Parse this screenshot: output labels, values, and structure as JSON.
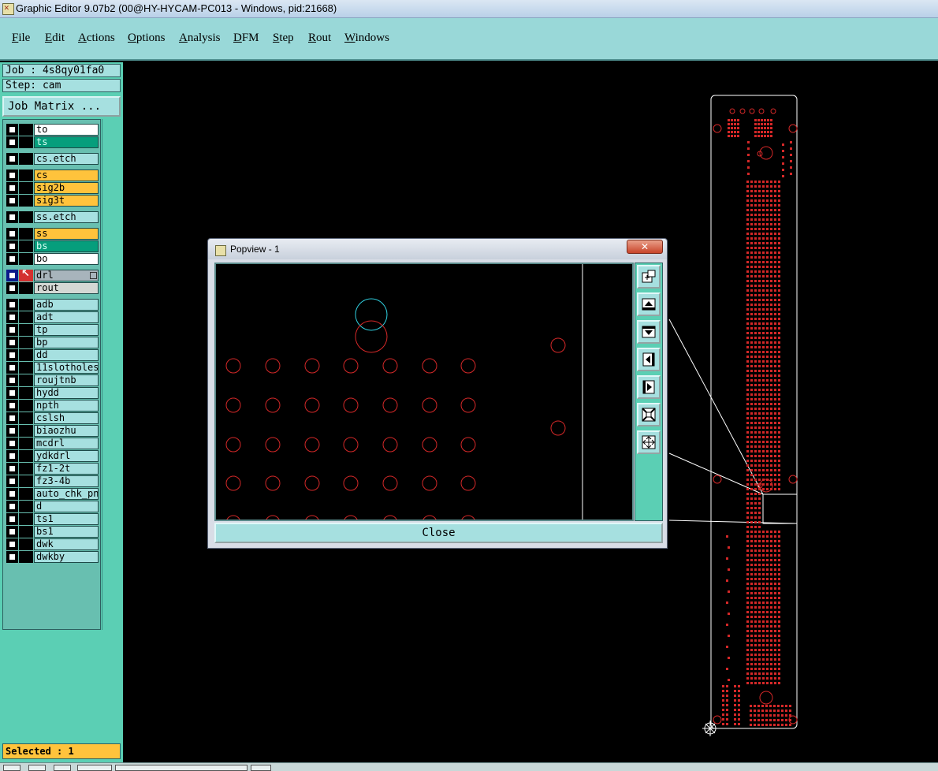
{
  "window": {
    "title": "Graphic Editor 9.07b2 (00@HY-HYCAM-PC013 - Windows, pid:21668)"
  },
  "menu": [
    "File",
    "Edit",
    "Actions",
    "Options",
    "Analysis",
    "DFM",
    "Step",
    "Rout",
    "Windows"
  ],
  "job": {
    "label": "Job : 4s8qy01fa0",
    "step": "Step: cam",
    "matrix_button": "Job Matrix ..."
  },
  "layers": [
    {
      "name": "to",
      "color": "#ffffff"
    },
    {
      "name": "ts",
      "color": "#069e7c"
    },
    {
      "name": "cs.etch",
      "color": "#a6e0e0"
    },
    {
      "name": "cs",
      "color": "#ffc33c"
    },
    {
      "name": "sig2b",
      "color": "#ffc33c"
    },
    {
      "name": "sig3t",
      "color": "#ffc33c"
    },
    {
      "name": "ss.etch",
      "color": "#a6e0e0"
    },
    {
      "name": "ss",
      "color": "#ffc33c"
    },
    {
      "name": "bs",
      "color": "#069e7c"
    },
    {
      "name": "bo",
      "color": "#ffffff"
    },
    {
      "name": "drl",
      "color": "#a8b4bc",
      "active": true
    },
    {
      "name": "rout",
      "color": "#d4d8d4"
    },
    {
      "name": "adb",
      "color": "#a6e0e0"
    },
    {
      "name": "adt",
      "color": "#a6e0e0"
    },
    {
      "name": "tp",
      "color": "#a6e0e0"
    },
    {
      "name": "bp",
      "color": "#a6e0e0"
    },
    {
      "name": "dd",
      "color": "#a6e0e0"
    },
    {
      "name": "11slotholes",
      "color": "#a6e0e0"
    },
    {
      "name": "roujtnb",
      "color": "#a6e0e0"
    },
    {
      "name": "hydd",
      "color": "#a6e0e0"
    },
    {
      "name": "npth",
      "color": "#a6e0e0"
    },
    {
      "name": "cslsh",
      "color": "#a6e0e0"
    },
    {
      "name": "biaozhu",
      "color": "#a6e0e0"
    },
    {
      "name": "mcdrl",
      "color": "#a6e0e0"
    },
    {
      "name": "ydkdrl",
      "color": "#a6e0e0"
    },
    {
      "name": "fz1-2t",
      "color": "#a6e0e0"
    },
    {
      "name": "fz3-4b",
      "color": "#a6e0e0"
    },
    {
      "name": "auto_chk_pn",
      "color": "#a6e0e0"
    },
    {
      "name": "d",
      "color": "#a6e0e0"
    },
    {
      "name": "ts1",
      "color": "#a6e0e0"
    },
    {
      "name": "bs1",
      "color": "#a6e0e0"
    },
    {
      "name": "dwk",
      "color": "#a6e0e0"
    },
    {
      "name": "dwkby",
      "color": "#a6e0e0"
    }
  ],
  "status": {
    "selected": "Selected : 1"
  },
  "popup": {
    "title": "Popview - 1",
    "close_x": "✕",
    "close_label": "Close",
    "toolbar": [
      "zoom-window-icon",
      "pan-up-icon",
      "pan-down-icon",
      "pan-left-icon",
      "pan-right-icon",
      "zoom-in-icon",
      "zoom-out-icon"
    ]
  },
  "colors": {
    "pad_red": "#d42828",
    "selected_cyan": "#30d0e0",
    "profile": "#ffffff",
    "panel_teal": "#5bcfb4",
    "menu_teal": "#99d8d8"
  }
}
